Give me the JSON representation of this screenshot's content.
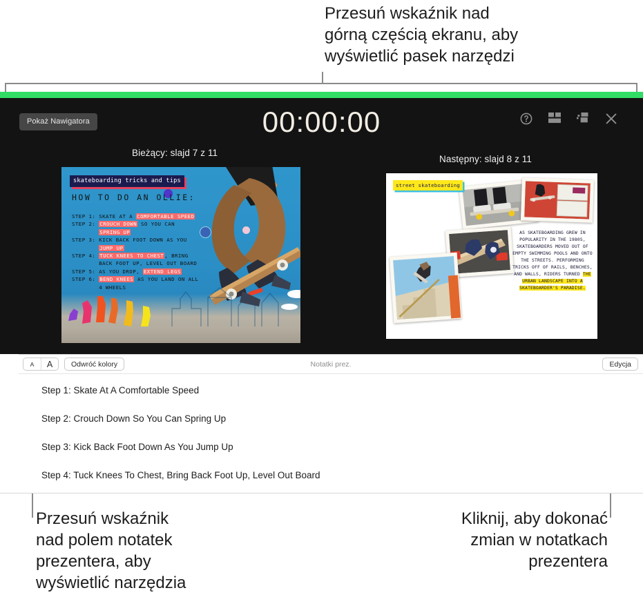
{
  "callouts": {
    "top": "Przesuń wskaźnik nad\ngórną częścią ekranu, aby\nwyświetlić pasek narzędzi",
    "bottom_left": "Przesuń wskaźnik\nnad polem notatek\nprezentera, aby\nwyświetlić narzędzia",
    "bottom_right": "Kliknij, aby dokonać\nzmian w notatkach\nprezentera"
  },
  "presenter": {
    "navigator_button": "Pokaż Nawigatora",
    "timer": "00:00:00",
    "icons": [
      {
        "name": "help-icon",
        "label": "?"
      },
      {
        "name": "layout-icon",
        "label": "Układ"
      },
      {
        "name": "swap-displays-icon",
        "label": "Zamień ekrany"
      },
      {
        "name": "close-icon",
        "label": "X"
      }
    ],
    "current_label": "Bieżący: slajd 7 z 11",
    "next_label": "Następny: slajd 8 z 11",
    "accent_color": "#31dd65",
    "background_color": "#131313"
  },
  "slide_current": {
    "tag": "skateboarding tricks and tips",
    "heading": "HOW TO DO AN OLLIE:",
    "steps": [
      {
        "prefix": "STEP 1: ",
        "parts": [
          {
            "t": "SKATE AT A ",
            "h": false
          },
          {
            "t": "COMFORTABLE SPEED",
            "h": true
          }
        ]
      },
      {
        "prefix": "STEP 2: ",
        "parts": [
          {
            "t": "CROUCH DOWN",
            "h": true
          },
          {
            "t": " SO YOU CAN",
            "h": false
          }
        ]
      },
      {
        "prefix": "",
        "parts": [
          {
            "t": "SPRING UP",
            "h": true
          }
        ]
      },
      {
        "prefix": "STEP 3: ",
        "parts": [
          {
            "t": "KICK BACK FOOT DOWN AS YOU",
            "h": false
          }
        ]
      },
      {
        "prefix": "",
        "parts": [
          {
            "t": "JUMP UP",
            "h": true
          }
        ]
      },
      {
        "prefix": "STEP 4: ",
        "parts": [
          {
            "t": "TUCK KNEES TO CHEST",
            "h": true
          },
          {
            "t": ", BRING",
            "h": false
          }
        ]
      },
      {
        "prefix": "",
        "parts": [
          {
            "t": "BACK FOOT UP, LEVEL OUT BOARD",
            "h": false
          }
        ]
      },
      {
        "prefix": "STEP 5: ",
        "parts": [
          {
            "t": "AS YOU DROP, ",
            "h": false
          },
          {
            "t": "EXTEND LEGS",
            "h": true
          }
        ]
      },
      {
        "prefix": "STEP 6: ",
        "parts": [
          {
            "t": "BEND KNEES",
            "h": true
          },
          {
            "t": " AS YOU LAND ON ALL",
            "h": false
          }
        ]
      },
      {
        "prefix": "",
        "parts": [
          {
            "t": "4 WHEELS",
            "h": false
          }
        ]
      }
    ]
  },
  "slide_next": {
    "tag": "street skateboarding",
    "body_plain": "AS SKATEBOARDING GREW IN POPULARITY IN THE 1980S, SKATEBOARDERS MOVED OUT OF EMPTY SWIMMING POOLS AND ONTO THE STREETS. PERFORMING TRICKS OFF OF RAILS, BENCHES, AND WALLS, RIDERS TURNED ",
    "body_highlight": "THE URBAN LANDSCAPE INTO A SKATEBOARDER'S PARADISE."
  },
  "notes": {
    "font_small_label": "A",
    "font_large_label": "A",
    "invert_label": "Odwróć kolory",
    "title": "Notatki prez.",
    "edit_label": "Edycja",
    "lines": [
      "Step 1: Skate At A Comfortable Speed",
      "Step 2: Crouch Down So You Can Spring Up",
      "Step 3: Kick Back Foot Down As You Jump Up",
      "Step 4: Tuck Knees To Chest, Bring Back Foot Up, Level Out Board"
    ]
  }
}
